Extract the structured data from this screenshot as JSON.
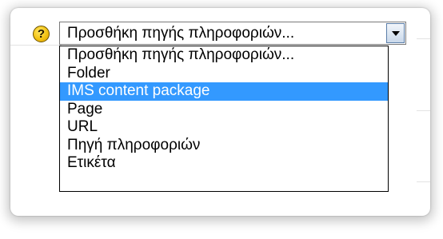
{
  "help": {
    "icon": "question-mark-icon",
    "glyph": "?"
  },
  "select": {
    "value": "Προσθήκη πηγής πληροφοριών...",
    "arrow_icon": "chevron-down-icon"
  },
  "dropdown": {
    "options": [
      {
        "label": "Προσθήκη πηγής πληροφοριών...",
        "selected": false
      },
      {
        "label": "Folder",
        "selected": false
      },
      {
        "label": "IMS content package",
        "selected": true
      },
      {
        "label": "Page",
        "selected": false
      },
      {
        "label": "URL",
        "selected": false
      },
      {
        "label": "Πηγή πληροφοριών",
        "selected": false
      },
      {
        "label": "Ετικέτα",
        "selected": false
      }
    ]
  },
  "colors": {
    "highlight": "#3399ff",
    "help_icon": "#f3c313"
  }
}
